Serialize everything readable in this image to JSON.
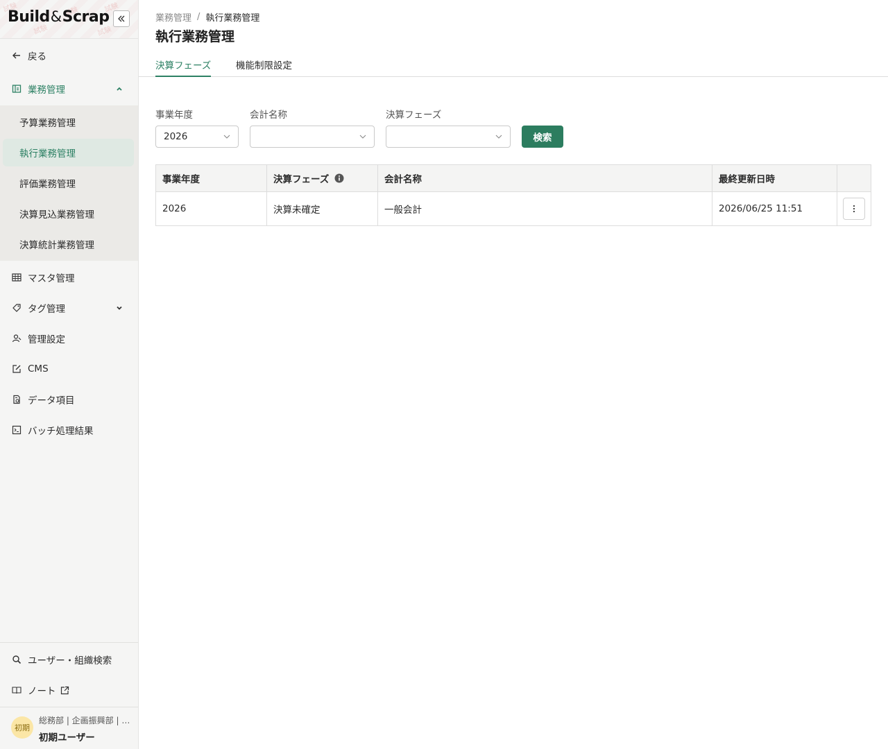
{
  "brand": {
    "name_left": "Build",
    "name_amp": "&",
    "name_right": "Scrap"
  },
  "sidebar": {
    "back_label": "戻る",
    "groups": [
      {
        "label": "業務管理",
        "icon": "calendar-list-icon",
        "expanded": true
      },
      {
        "label": "マスタ管理",
        "icon": "table-icon"
      },
      {
        "label": "タグ管理",
        "icon": "tag-icon",
        "expanded": false
      },
      {
        "label": "管理設定",
        "icon": "user-settings-icon"
      },
      {
        "label": "CMS",
        "icon": "edit-icon"
      },
      {
        "label": "データ項目",
        "icon": "data-item-icon"
      },
      {
        "label": "バッチ処理結果",
        "icon": "terminal-icon"
      }
    ],
    "sub_items": [
      "予算業務管理",
      "執行業務管理",
      "評価業務管理",
      "決算見込業務管理",
      "決算統計業務管理"
    ],
    "active_sub": "執行業務管理",
    "bottom_items": [
      {
        "label": "ユーザー・組織検索",
        "icon": "search-icon"
      },
      {
        "label": "ノート",
        "icon": "book-icon"
      }
    ],
    "user": {
      "avatar": "初期",
      "org": "総務部 | 企画振興部 | …",
      "name": "初期ユーザー"
    }
  },
  "breadcrumb": {
    "parent": "業務管理",
    "separator": "/",
    "current": "執行業務管理"
  },
  "page_title": "執行業務管理",
  "tabs": [
    {
      "label": "決算フェーズ",
      "active": true
    },
    {
      "label": "機能制限設定",
      "active": false
    }
  ],
  "filters": {
    "fiscal_year": {
      "label": "事業年度",
      "value": "2026"
    },
    "account_name": {
      "label": "会計名称",
      "value": ""
    },
    "settlement_phase": {
      "label": "決算フェーズ",
      "value": ""
    },
    "search_label": "検索"
  },
  "table": {
    "headers": [
      "事業年度",
      "決算フェーズ",
      "会計名称",
      "最終更新日時",
      ""
    ],
    "rows": [
      [
        "2026",
        "決算未確定",
        "一般会計",
        "2026/06/25 11:51"
      ]
    ]
  },
  "colors": {
    "accent": "#2c8063",
    "button": "#2c7d5f"
  }
}
